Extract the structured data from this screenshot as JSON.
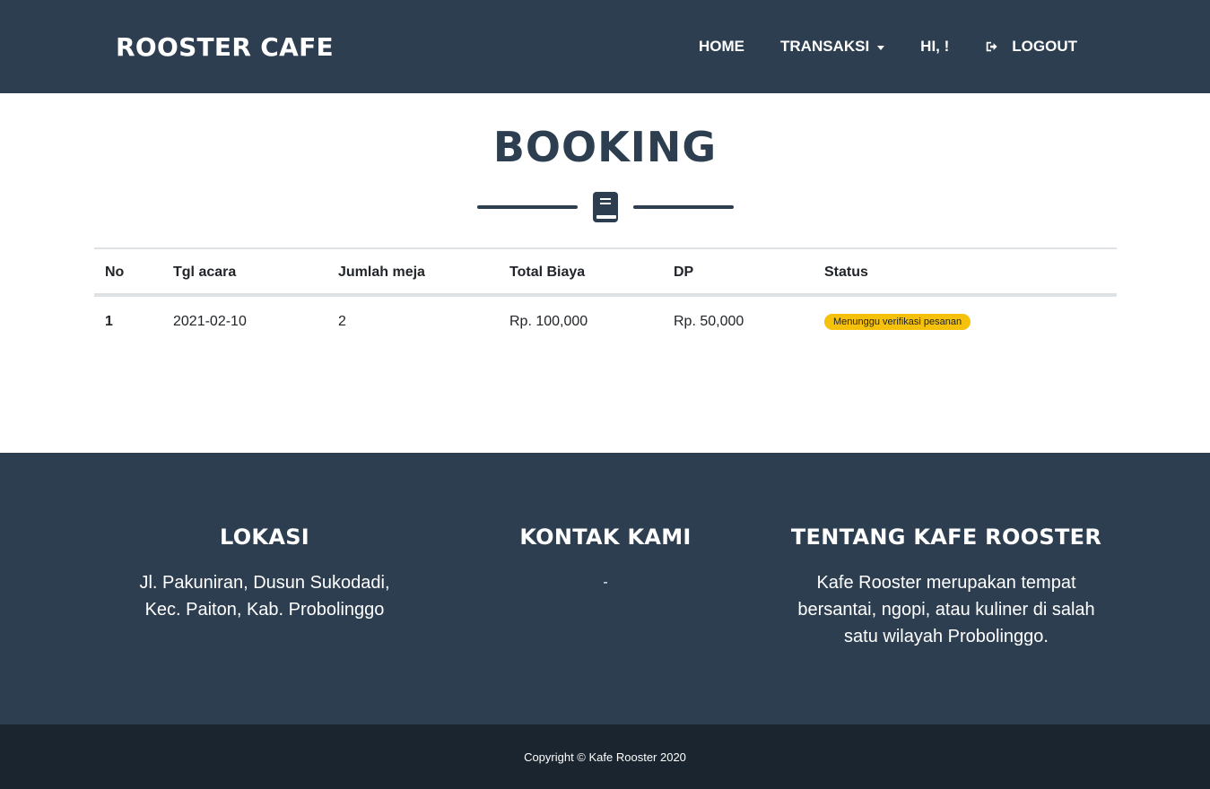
{
  "navbar": {
    "brand": "ROOSTER CAFE",
    "items": {
      "home": "HOME",
      "transaksi": "TRANSAKSI",
      "greeting": "HI, !",
      "logout": "LOGOUT"
    }
  },
  "page": {
    "title": "BOOKING",
    "divider_icon": "book-icon"
  },
  "table": {
    "headers": {
      "no": "No",
      "tgl": "Tgl acara",
      "meja": "Jumlah meja",
      "biaya": "Total Biaya",
      "dp": "DP",
      "status": "Status"
    },
    "rows": [
      {
        "no": "1",
        "tgl": "2021-02-10",
        "meja": "2",
        "biaya": "Rp. 100,000",
        "dp": "Rp. 50,000",
        "status": "Menunggu verifikasi pesanan"
      }
    ]
  },
  "footer": {
    "lokasi": {
      "heading": "LOKASI",
      "line1": "Jl. Pakuniran, Dusun Sukodadi,",
      "line2": "Kec. Paiton, Kab. Probolinggo"
    },
    "kontak": {
      "heading": "KONTAK KAMI",
      "text": "-"
    },
    "tentang": {
      "heading": "TENTANG KAFE ROOSTER",
      "text": "Kafe Rooster merupakan tempat bersantai, ngopi, atau kuliner di salah satu wilayah Probolinggo."
    },
    "copyright": "Copyright © Kafe Rooster 2020"
  },
  "colors": {
    "primary": "#2c3e50",
    "dark": "#1a252f",
    "badge_warning": "#f6c10b"
  }
}
